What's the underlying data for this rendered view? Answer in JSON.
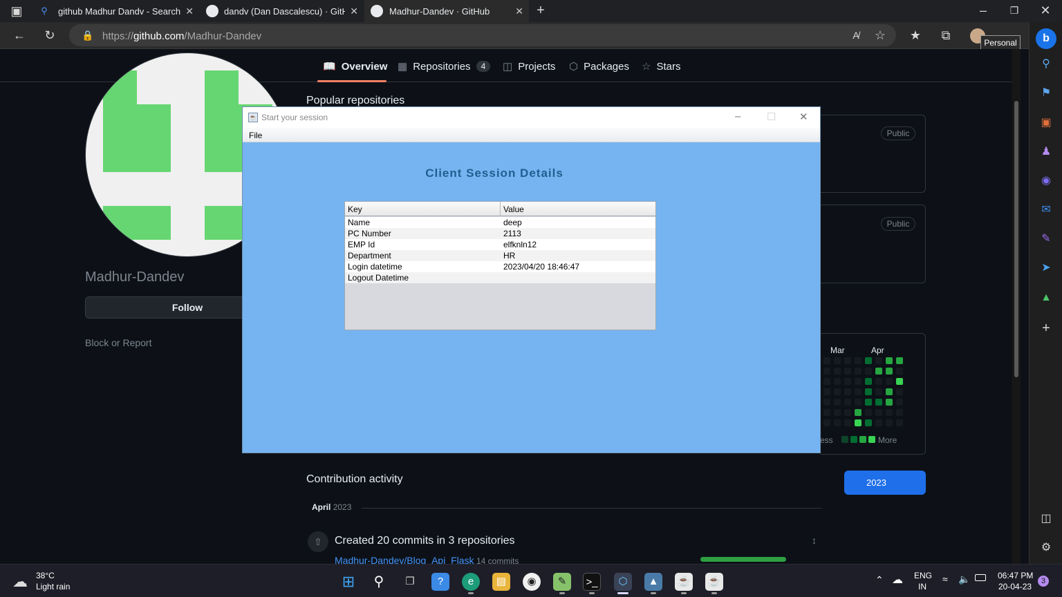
{
  "browser": {
    "tabs": [
      {
        "label": "github Madhur Dandv - Search",
        "icon": "search-icon"
      },
      {
        "label": "dandv (Dan Dascalescu) · GitHub",
        "icon": "github-icon"
      },
      {
        "label": "Madhur-Dandev · GitHub",
        "icon": "github-icon"
      }
    ],
    "url_prefix": "https://",
    "url_domain": "github.com",
    "url_path": "/Madhur-Dandev",
    "profile_tooltip": "Personal"
  },
  "github": {
    "nav": [
      {
        "label": "Overview",
        "icon": "book-icon"
      },
      {
        "label": "Repositories",
        "icon": "repo-icon"
      },
      {
        "label": "Projects",
        "icon": "table-icon"
      },
      {
        "label": "Packages",
        "icon": "package-icon"
      },
      {
        "label": "Stars",
        "icon": "star-icon"
      }
    ],
    "repo_count": "4",
    "username": "Madhur-Dandev",
    "follow_label": "Follow",
    "block_label": "Block or Report",
    "popular_repos_title": "Popular repositories",
    "public_badge": "Public",
    "months": [
      "Mar",
      "Apr"
    ],
    "legend_less": "ess",
    "legend_more": "More",
    "contribution_activity": "Contribution activity",
    "year": "2023",
    "month_label": "April",
    "month_year": "2023",
    "commit_summary": "Created 20 commits in 3 repositories",
    "repo_link": "Madhur-Dandev/Blog_Api_Flask",
    "repo_commits": "14 commits"
  },
  "java_window": {
    "title": "Start your session",
    "menu_file": "File",
    "heading": "Client Session Details",
    "columns": [
      "Key",
      "Value"
    ],
    "rows": [
      {
        "key": "Name",
        "value": "deep"
      },
      {
        "key": "PC Number",
        "value": "2113"
      },
      {
        "key": "EMP Id",
        "value": "elfknln12"
      },
      {
        "key": "Department",
        "value": "HR"
      },
      {
        "key": "Login datetime",
        "value": "2023/04/20 18:46:47"
      },
      {
        "key": "Logout Datetime",
        "value": ""
      }
    ]
  },
  "taskbar": {
    "weather_temp": "38°C",
    "weather_desc": "Light rain",
    "lang_1": "ENG",
    "lang_2": "IN",
    "time": "06:47 PM",
    "date": "20-04-23",
    "notifications": "3"
  },
  "colors": {
    "java_bg": "#76b4f1",
    "heading": "#1f5f8f",
    "github_bg": "#0d1117",
    "accent": "#1f6feb"
  }
}
